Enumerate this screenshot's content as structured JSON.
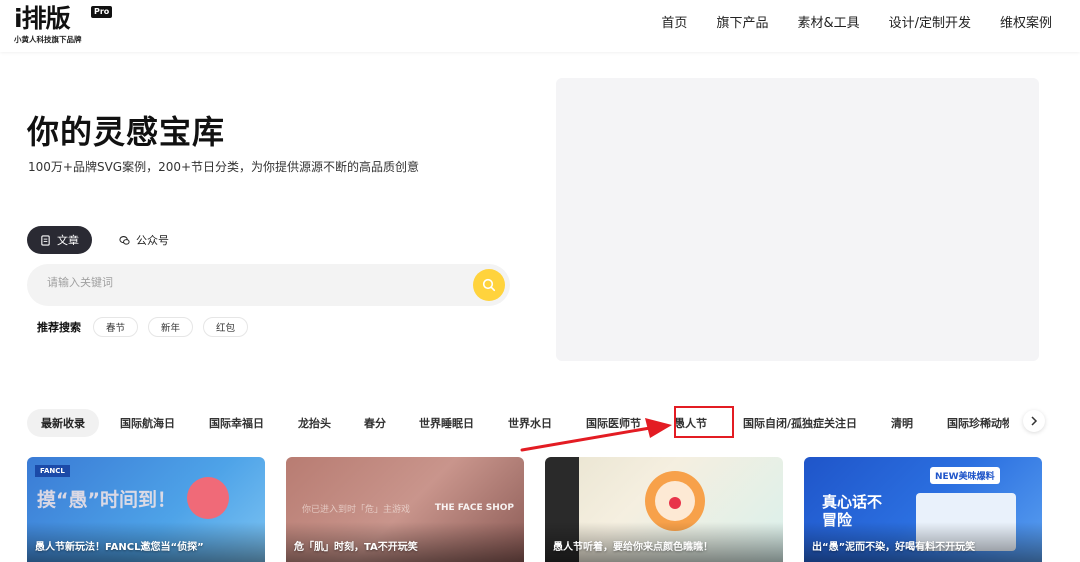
{
  "header": {
    "logo_text": "i排版",
    "logo_badge": "Pro",
    "logo_sub": "小黄人科技旗下品牌",
    "nav": [
      "首页",
      "旗下产品",
      "素材&工具",
      "设计/定制开发",
      "维权案例"
    ]
  },
  "hero": {
    "title": "你的灵感宝库",
    "subtitle": "100万+品牌SVG案例，200+节日分类，为你提供源源不断的高品质创意",
    "tabs": [
      {
        "label": "文章",
        "icon": "document-icon",
        "active": true
      },
      {
        "label": "公众号",
        "icon": "wechat-icon",
        "active": false
      }
    ],
    "search": {
      "placeholder": "请输入关键词",
      "value": ""
    },
    "recommend_label": "推荐搜索",
    "recommend_tags": [
      "春节",
      "新年",
      "红包"
    ]
  },
  "categories": {
    "items": [
      "最新收录",
      "国际航海日",
      "国际幸福日",
      "龙抬头",
      "春分",
      "世界睡眠日",
      "世界水日",
      "国际医师节",
      "愚人节",
      "国际自闭/孤独症关注日",
      "清明",
      "国际珍稀动物"
    ],
    "active_index": 0,
    "highlighted_index": 8
  },
  "cards": [
    {
      "caption": "愚人节新玩法！FANCL邀您当“侦探”",
      "badge": "FANCL",
      "art_text": "摸“愚”时间到！"
    },
    {
      "caption": "危「肌」时刻，TA不开玩笑",
      "badge": "THE FACE SHOP",
      "art_text": "你已进入到时「危」主游戏"
    },
    {
      "caption": "愚人节听着，要给你来点颜色瞧瞧！",
      "badge": "",
      "art_text": ""
    },
    {
      "caption": "出“愚”泥而不染，好喝有料不开玩笑",
      "badge": "NEW美味爆料",
      "art_text": "真心话不冒险"
    }
  ],
  "colors": {
    "accent_yellow": "#ffd33d",
    "active_tab": "#2a2a33",
    "annotation_red": "#e31c23"
  }
}
